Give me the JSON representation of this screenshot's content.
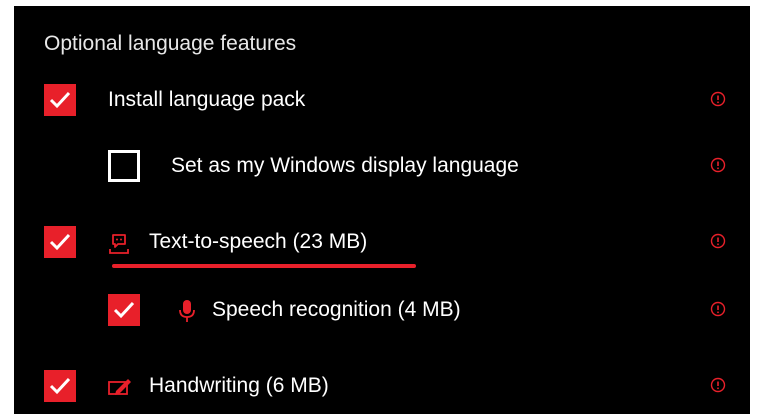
{
  "section": {
    "title": "Optional language features"
  },
  "colors": {
    "accent": "#e8202a",
    "background": "#000000",
    "text": "#ffffff"
  },
  "features": [
    {
      "label": "Install language pack",
      "checked": true,
      "level": 0,
      "icon": ""
    },
    {
      "label": "Set as my Windows display language",
      "checked": false,
      "level": 1,
      "icon": ""
    },
    {
      "label": "Text-to-speech (23 MB)",
      "checked": true,
      "level": 0,
      "icon": "speech-bubble-icon"
    },
    {
      "label": "Speech recognition (4 MB)",
      "checked": true,
      "level": 1,
      "icon": "microphone-icon"
    },
    {
      "label": "Handwriting (6 MB)",
      "checked": true,
      "level": 0,
      "icon": "pen-icon"
    }
  ],
  "info_icon": "info-icon",
  "annotation": {
    "type": "red-underline",
    "target": "Text-to-speech (23 MB)"
  }
}
